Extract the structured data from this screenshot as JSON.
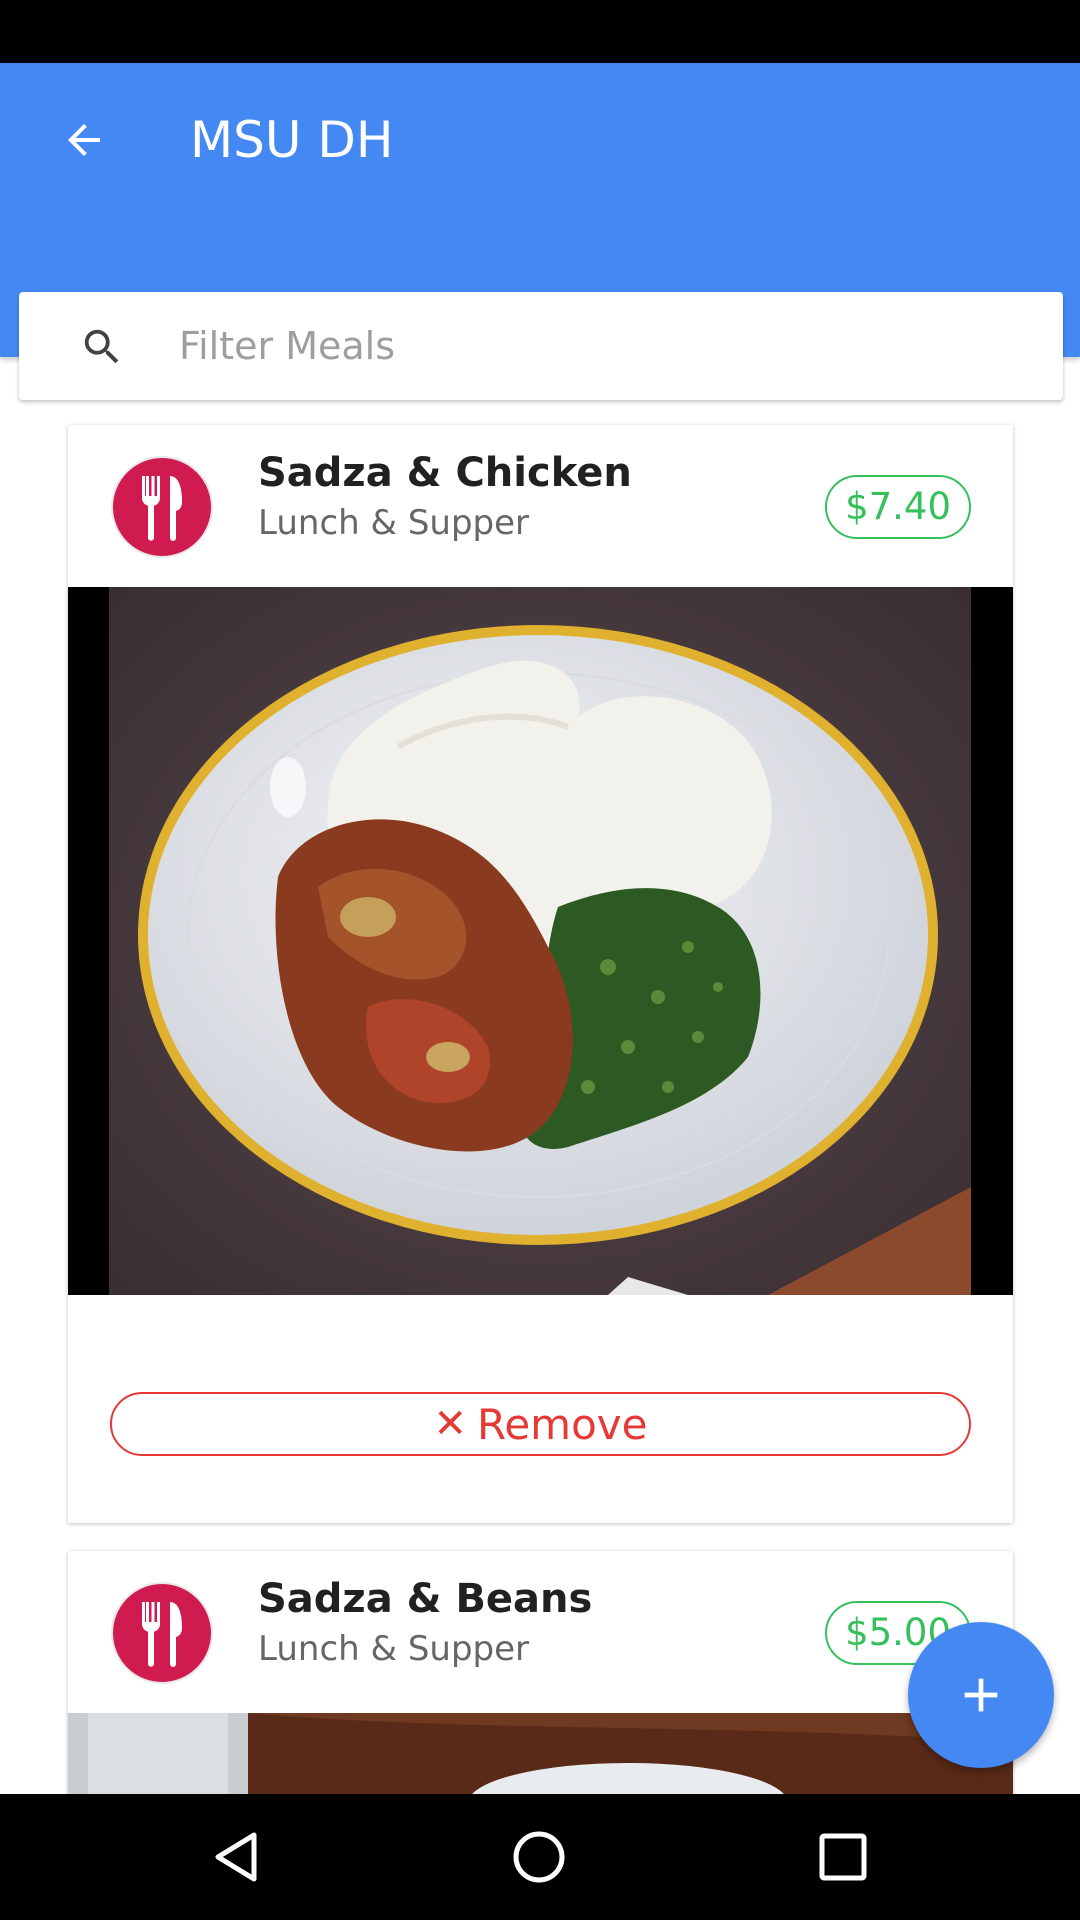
{
  "app_bar": {
    "title": "MSU DH",
    "back_icon": "arrow-back-icon",
    "color": "#4489F3"
  },
  "search": {
    "placeholder": "Filter Meals",
    "value": "",
    "icon": "search-icon"
  },
  "meals": [
    {
      "name": "Sadza & Chicken",
      "type": "Lunch & Supper",
      "price": "$7.40",
      "icon": "cutlery-icon",
      "remove_label": "Remove",
      "remove_icon": "✕"
    },
    {
      "name": "Sadza & Beans",
      "type": "Lunch & Supper",
      "price": "$5.00",
      "icon": "cutlery-icon"
    }
  ],
  "fab": {
    "icon": "add-icon"
  },
  "nav": {
    "back": "nav-back-icon",
    "home": "nav-home-icon",
    "recents": "nav-recents-icon"
  },
  "colors": {
    "accent": "#4489F3",
    "price": "#35C05C",
    "remove": "#E53935",
    "avatar": "#D01B50"
  }
}
